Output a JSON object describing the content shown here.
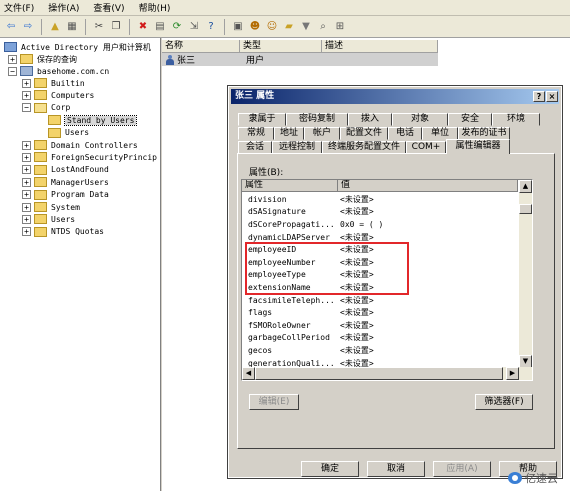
{
  "menu": [
    "文件(F)",
    "操作(A)",
    "查看(V)",
    "帮助(H)"
  ],
  "toolbar_icons": [
    {
      "name": "back-icon",
      "glyph": "⇦",
      "color": "#2f6fd1"
    },
    {
      "name": "forward-icon",
      "glyph": "⇨",
      "color": "#2f6fd1"
    },
    {
      "name": "up-folder-icon",
      "glyph": "▲",
      "color": "#c9a227"
    },
    {
      "name": "show-tree-icon",
      "glyph": "▦",
      "color": "#555555"
    },
    {
      "name": "cut-icon",
      "glyph": "✂",
      "color": "#444444"
    },
    {
      "name": "copy-icon",
      "glyph": "❐",
      "color": "#444444"
    },
    {
      "name": "delete-icon",
      "glyph": "✖",
      "color": "#d11b1b"
    },
    {
      "name": "properties-icon",
      "glyph": "▤",
      "color": "#555555"
    },
    {
      "name": "refresh-icon",
      "glyph": "⟳",
      "color": "#2a8a2a"
    },
    {
      "name": "export-icon",
      "glyph": "⇲",
      "color": "#555555"
    },
    {
      "name": "help-icon",
      "glyph": "?",
      "color": "#1a4fa0"
    },
    {
      "name": "console-icon",
      "glyph": "▣",
      "color": "#555555"
    },
    {
      "name": "new-user-icon",
      "glyph": "☻",
      "color": "#b36b00"
    },
    {
      "name": "new-group-icon",
      "glyph": "☺",
      "color": "#b36b00"
    },
    {
      "name": "new-ou-icon",
      "glyph": "▰",
      "color": "#c9a227"
    },
    {
      "name": "filter-icon",
      "glyph": "▼",
      "color": "#777777"
    },
    {
      "name": "find-icon",
      "glyph": "⌕",
      "color": "#555555"
    },
    {
      "name": "add-to-group-icon",
      "glyph": "⊞",
      "color": "#555555"
    }
  ],
  "tree": {
    "root": "Active Directory 用户和计算机",
    "saved_queries": "保存的查询",
    "domain": "basehome.com.cn",
    "nodes": [
      "Builtin",
      "Computers",
      "Corp",
      "Stand by Users",
      "Users",
      "Domain Controllers",
      "ForeignSecurityPrincip",
      "LostAndFound",
      "ManagerUsers",
      "Program Data",
      "System",
      "Users",
      "NTDS Quotas"
    ]
  },
  "list": {
    "headers": [
      "名称",
      "类型",
      "描述"
    ],
    "row": {
      "name": "张三",
      "type": "用户",
      "desc": ""
    }
  },
  "dialog": {
    "title": "张三 属性",
    "help_btn": "?",
    "close_btn": "×",
    "tabs_row1": [
      "隶属于",
      "密码复制",
      "拨入",
      "对象",
      "安全",
      "环境"
    ],
    "tabs_row2": [
      "常规",
      "地址",
      "帐户",
      "配置文件",
      "电话",
      "单位",
      "发布的证书"
    ],
    "tabs_row3": [
      "会话",
      "远程控制",
      "终端服务配置文件",
      "COM+",
      "属性编辑器"
    ],
    "attr_label": "属性(B):",
    "col_attr": "属性",
    "col_value": "值",
    "rows": [
      {
        "attr": "division",
        "value": "<未设置>"
      },
      {
        "attr": "dSASignature",
        "value": "<未设置>"
      },
      {
        "attr": "dSCorePropagati...",
        "value": "0x0 = ( )"
      },
      {
        "attr": "dynamicLDAPServer",
        "value": "<未设置>"
      },
      {
        "attr": "employeeID",
        "value": "<未设置>"
      },
      {
        "attr": "employeeNumber",
        "value": "<未设置>"
      },
      {
        "attr": "employeeType",
        "value": "<未设置>"
      },
      {
        "attr": "extensionName",
        "value": "<未设置>"
      },
      {
        "attr": "facsimileTeleph...",
        "value": "<未设置>"
      },
      {
        "attr": "flags",
        "value": "<未设置>"
      },
      {
        "attr": "fSMORoleOwner",
        "value": "<未设置>"
      },
      {
        "attr": "garbageCollPeriod",
        "value": "<未设置>"
      },
      {
        "attr": "gecos",
        "value": "<未设置>"
      },
      {
        "attr": "generationQuali...",
        "value": "<未设置>"
      }
    ],
    "edit_btn": "编辑(E)",
    "filter_btn": "筛选器(F)",
    "ok_btn": "确定",
    "cancel_btn": "取消",
    "apply_btn": "应用(A)",
    "help_bottom_btn": "帮助"
  },
  "watermark": "亿速云",
  "colors": {
    "highlight": "#e2272a",
    "title_start": "#0a246a",
    "title_end": "#a6caf0"
  }
}
